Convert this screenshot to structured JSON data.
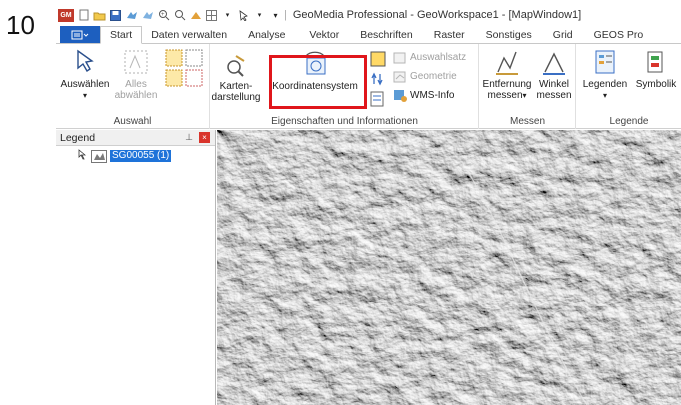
{
  "step_number": "10",
  "window": {
    "title": "GeoMedia Professional - GeoWorkspace1 - [MapWindow1]",
    "logo_text": "GM"
  },
  "tabs": [
    "Start",
    "Daten verwalten",
    "Analyse",
    "Vektor",
    "Beschriften",
    "Raster",
    "Sonstiges",
    "Grid",
    "GEOS Pro"
  ],
  "ribbon": {
    "auswahl": {
      "label": "Auswahl",
      "select_label": "Auswählen",
      "deselect_label_1": "Alles",
      "deselect_label_2": "abwählen"
    },
    "eigenschaften": {
      "label": "Eigenschaften und Informationen",
      "karten_1": "Karten-",
      "karten_2": "darstellung",
      "koordinaten": "Koordinatensystem",
      "auswahlsatz": "Auswahlsatz",
      "geometrie": "Geometrie",
      "wms": "WMS-Info"
    },
    "messen": {
      "label": "Messen",
      "entfernung_1": "Entfernung",
      "entfernung_2": "messen",
      "winkel_1": "Winkel",
      "winkel_2": "messen"
    },
    "legende": {
      "label": "Legende",
      "legenden": "Legenden",
      "symbolik": "Symbolik"
    }
  },
  "legend_panel": {
    "title": "Legend",
    "items": [
      {
        "label": "SG00055 (1)"
      }
    ]
  },
  "colors": {
    "accent": "#1d5fbf",
    "highlight": "#e0161b",
    "selection": "#1e73d9"
  }
}
